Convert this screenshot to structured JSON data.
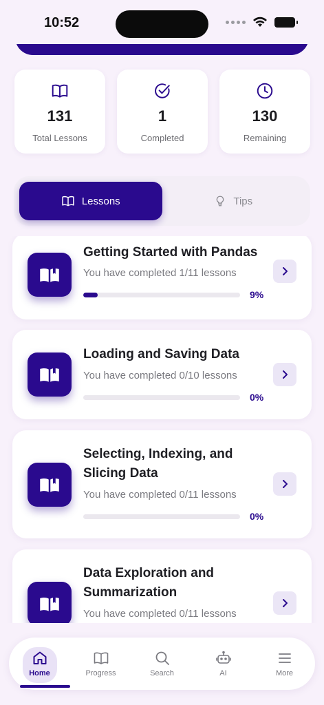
{
  "status_bar": {
    "time": "10:52"
  },
  "stats": [
    {
      "icon": "book-open-icon",
      "value": "131",
      "label": "Total Lessons"
    },
    {
      "icon": "check-circle-icon",
      "value": "1",
      "label": "Completed"
    },
    {
      "icon": "clock-icon",
      "value": "130",
      "label": "Remaining"
    }
  ],
  "tabs": {
    "lessons": {
      "label": "Lessons",
      "icon": "book-open-icon",
      "active": true
    },
    "tips": {
      "label": "Tips",
      "icon": "lightbulb-icon",
      "active": false
    }
  },
  "lessons": [
    {
      "title_line1": "Getting Started with Pandas",
      "title_line2": "",
      "subtitle": "You have completed 1/11 lessons",
      "progress": 0.09,
      "percent": "9%"
    },
    {
      "title_line1": "Loading and Saving Data",
      "title_line2": "",
      "subtitle": "You have completed 0/10 lessons",
      "progress": 0,
      "percent": "0%"
    },
    {
      "title_line1": "Selecting, Indexing, and",
      "title_line2": "Slicing Data",
      "subtitle": "You have completed 0/11 lessons",
      "progress": 0,
      "percent": "0%"
    },
    {
      "title_line1": "Data Exploration and",
      "title_line2": "Summarization",
      "subtitle": "You have completed 0/11 lessons",
      "progress": 0,
      "percent": ""
    }
  ],
  "nav": {
    "home": "Home",
    "progress": "Progress",
    "search": "Search",
    "ai": "AI",
    "more": "More"
  },
  "colors": {
    "accent": "#2a0a8e",
    "background": "#f8f1fb"
  }
}
